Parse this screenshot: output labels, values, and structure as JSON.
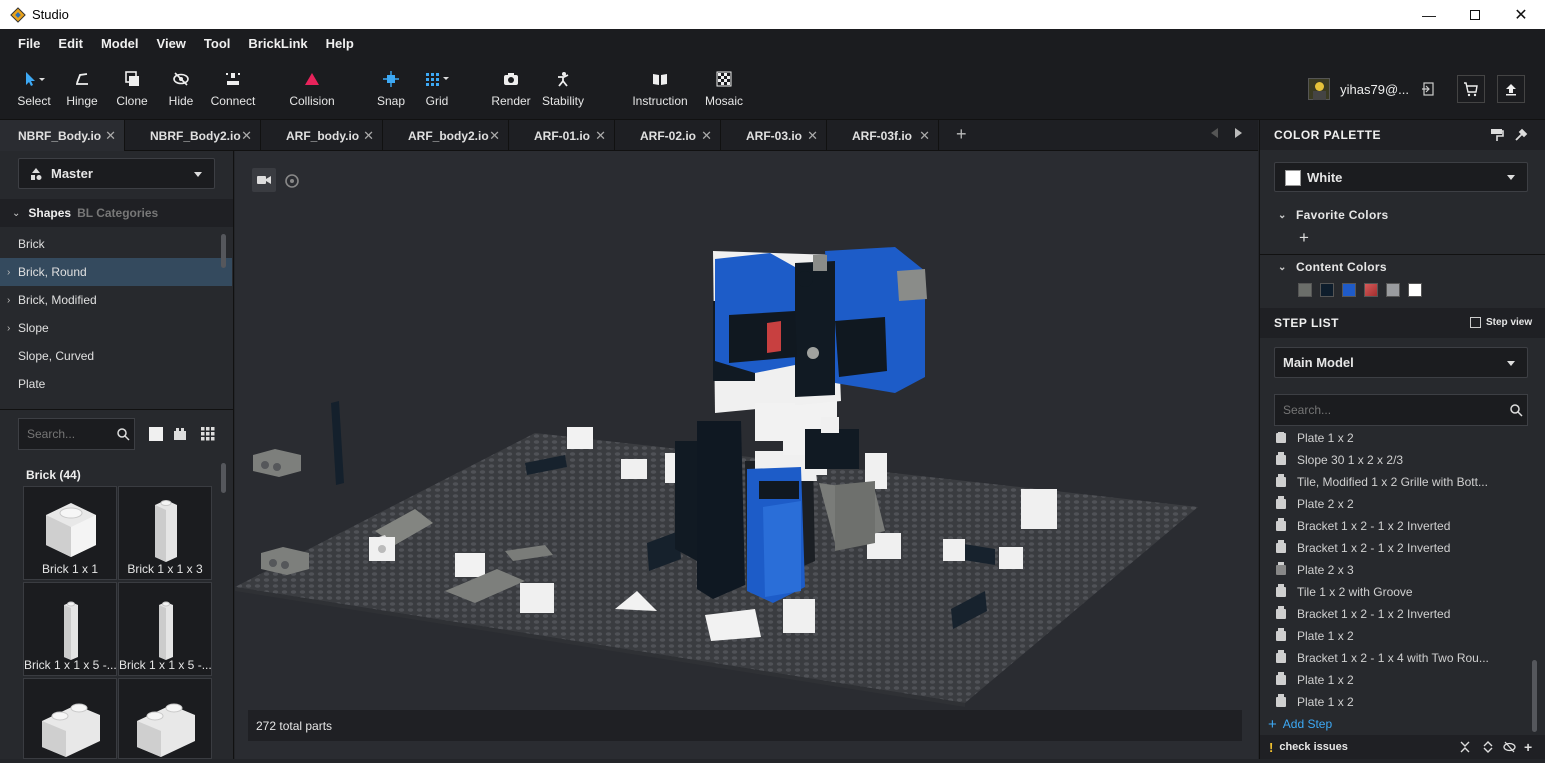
{
  "window": {
    "title": "Studio"
  },
  "menu": [
    "File",
    "Edit",
    "Model",
    "View",
    "Tool",
    "BrickLink",
    "Help"
  ],
  "toolbar": {
    "select": "Select",
    "hinge": "Hinge",
    "clone": "Clone",
    "hide": "Hide",
    "connect": "Connect",
    "collision": "Collision",
    "snap": "Snap",
    "grid": "Grid",
    "render": "Render",
    "stability": "Stability",
    "instruction": "Instruction",
    "mosaic": "Mosaic"
  },
  "user": {
    "name": "yihas79@..."
  },
  "tabs": [
    "NBRF_Body.io",
    "NBRF_Body2.io",
    "ARF_body.io",
    "ARF_body2.io",
    "ARF-01.io",
    "ARF-02.io",
    "ARF-03.io",
    "ARF-03f.io"
  ],
  "left": {
    "palette_select": "Master",
    "shape_tab": "Shapes",
    "bl_tab": "BL Categories",
    "categories": [
      "Brick",
      "Brick, Round",
      "Brick, Modified",
      "Slope",
      "Slope, Curved",
      "Plate"
    ],
    "search_placeholder": "Search...",
    "group_title": "Brick (44)",
    "parts": [
      "Brick 1 x 1",
      "Brick 1 x 1 x 3",
      "Brick 1 x 1 x 5 -...",
      "Brick 1 x 1 x 5 -..."
    ]
  },
  "viewport": {
    "status": "272 total parts"
  },
  "colors": {
    "accent": "#3da9f5",
    "selected_color_hex": "#ffffff",
    "content_swatches": [
      "#6b6e6a",
      "#0e1d2c",
      "#1f5bc8",
      "#b83b3b",
      "#9a9c9f",
      "#ffffff"
    ]
  },
  "right": {
    "palette_title": "COLOR PALETTE",
    "selected_color": "White",
    "favorite_title": "Favorite Colors",
    "content_title": "Content Colors",
    "steplist_title": "STEP LIST",
    "step_view": "Step view",
    "model_select": "Main Model",
    "search_placeholder": "Search...",
    "steps": [
      "Plate 1 x 2",
      "Slope 30 1 x 2 x 2/3",
      "Tile, Modified 1 x 2 Grille with Bott...",
      "Plate 2 x 2",
      "Bracket 1 x 2 - 1 x 2 Inverted",
      "Bracket 1 x 2 - 1 x 2 Inverted",
      "Plate 2 x 3",
      "Tile 1 x 2 with Groove",
      "Bracket 1 x 2 - 1 x 2 Inverted",
      "Plate 1 x 2",
      "Bracket 1 x 2 - 1 x 4 with Two Rou...",
      "Plate 1 x 2",
      "Plate 1 x 2"
    ],
    "add_step": "Add Step",
    "check_issues": "check issues"
  }
}
